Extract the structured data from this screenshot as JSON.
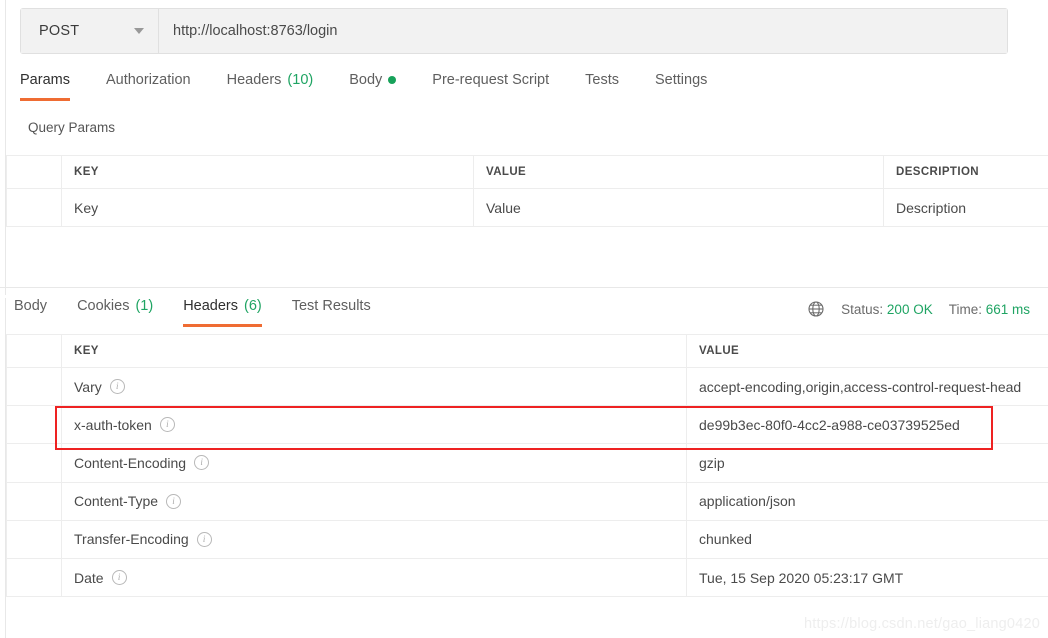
{
  "request": {
    "method": "POST",
    "method_caret_icon": "chevron-down-icon",
    "url": "http://localhost:8763/login",
    "url_placeholder": "Enter request URL",
    "tabs": [
      {
        "label": "Params",
        "active": true,
        "count": "",
        "dot": false
      },
      {
        "label": "Authorization",
        "active": false,
        "count": "",
        "dot": false
      },
      {
        "label": "Headers",
        "active": false,
        "count": "(10)",
        "dot": false
      },
      {
        "label": "Body",
        "active": false,
        "count": "",
        "dot": true
      },
      {
        "label": "Pre-request Script",
        "active": false,
        "count": "",
        "dot": false
      },
      {
        "label": "Tests",
        "active": false,
        "count": "",
        "dot": false
      },
      {
        "label": "Settings",
        "active": false,
        "count": "",
        "dot": false
      }
    ],
    "query_params_title": "Query Params",
    "params_table": {
      "columns": [
        "",
        "KEY",
        "VALUE",
        "DESCRIPTION"
      ],
      "rows": [
        {
          "checkbox": "",
          "key": "Key",
          "value": "Value",
          "description": "Description",
          "is_placeholder": true
        }
      ]
    }
  },
  "response": {
    "tabs": [
      {
        "label": "Body",
        "active": false,
        "count": ""
      },
      {
        "label": "Cookies",
        "active": false,
        "count": "(1)"
      },
      {
        "label": "Headers",
        "active": true,
        "count": "(6)"
      },
      {
        "label": "Test Results",
        "active": false,
        "count": ""
      }
    ],
    "meta": {
      "globe_icon": "globe-icon",
      "status_label": "Status:",
      "status_value": "200 OK",
      "time_label": "Time:",
      "time_value": "661 ms"
    },
    "headers_table": {
      "columns": [
        "",
        "KEY",
        "VALUE"
      ],
      "rows": [
        {
          "key": "Vary",
          "value": "accept-encoding,origin,access-control-request-head",
          "highlighted": false
        },
        {
          "key": "x-auth-token",
          "value": "de99b3ec-80f0-4cc2-a988-ce03739525ed",
          "highlighted": true
        },
        {
          "key": "Content-Encoding",
          "value": "gzip",
          "highlighted": false
        },
        {
          "key": "Content-Type",
          "value": "application/json",
          "highlighted": false
        },
        {
          "key": "Transfer-Encoding",
          "value": "chunked",
          "highlighted": false
        },
        {
          "key": "Date",
          "value": "Tue, 15 Sep 2020 05:23:17 GMT",
          "highlighted": false
        }
      ]
    }
  },
  "watermark": "https://blog.csdn.net/gao_liang0420",
  "colors": {
    "accent": "#ef6c33",
    "success": "#1fa463",
    "highlight": "#ee2222"
  }
}
